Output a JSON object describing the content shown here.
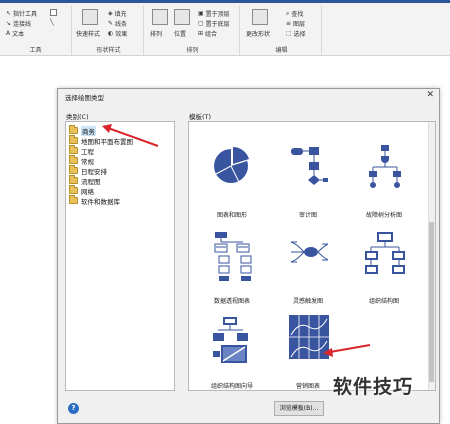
{
  "ribbon": {
    "groups": {
      "tools": {
        "label": "工具",
        "items": [
          "指针工具",
          "连接线",
          "文本"
        ]
      },
      "shape_style": {
        "label": "形状样式",
        "quick_style": "快速样式",
        "items": [
          "填充",
          "线条",
          "效果"
        ]
      },
      "arrange": {
        "label": "排列",
        "big": [
          "排列",
          "位置"
        ],
        "items": [
          "置于顶层",
          "置于底层",
          "组合"
        ]
      },
      "edit": {
        "label": "编辑",
        "big": "更改形状",
        "items": [
          "查找",
          "图层",
          "选择"
        ]
      }
    }
  },
  "dialog": {
    "title": "选择绘图类型",
    "close": "✕",
    "category_label": "类别(C)",
    "template_label": "模板(T)",
    "categories": [
      "商务",
      "地图和平面布置图",
      "工程",
      "常规",
      "日程安排",
      "流程图",
      "网络",
      "软件和数据库"
    ],
    "templates": [
      "图表和图形",
      "审计图",
      "故障树分析图",
      "数据透视图表",
      "灵感触发图",
      "组织结构图",
      "组织结构图向导",
      "营销图表"
    ],
    "help": "?",
    "browse_button": "浏览模板(B)..."
  },
  "watermark": "软件技巧",
  "colors": {
    "accent": "#2b579a",
    "template_blue": "#3a55a0",
    "arrow_red": "#d9262c"
  }
}
